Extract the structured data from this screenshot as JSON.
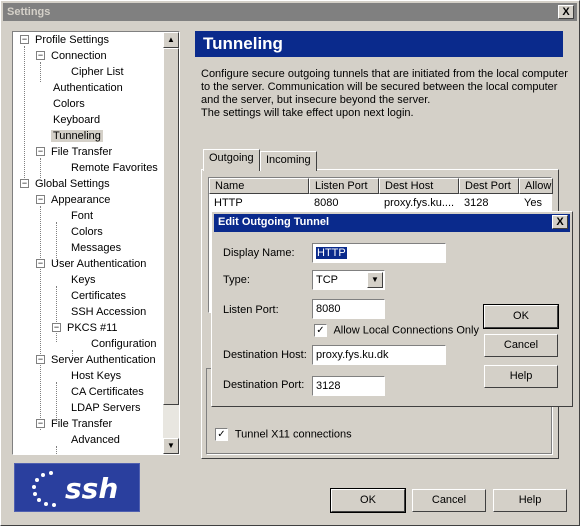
{
  "window": {
    "title": "Settings",
    "close_glyph": "X"
  },
  "tree": {
    "items": [
      {
        "label": "Profile Settings"
      },
      {
        "label": "Connection"
      },
      {
        "label": "Cipher List"
      },
      {
        "label": "Authentication"
      },
      {
        "label": "Colors"
      },
      {
        "label": "Keyboard"
      },
      {
        "label": "Tunneling"
      },
      {
        "label": "File Transfer"
      },
      {
        "label": "Remote Favorites"
      },
      {
        "label": "Global Settings"
      },
      {
        "label": "Appearance"
      },
      {
        "label": "Font"
      },
      {
        "label": "Colors"
      },
      {
        "label": "Messages"
      },
      {
        "label": "User Authentication"
      },
      {
        "label": "Keys"
      },
      {
        "label": "Certificates"
      },
      {
        "label": "SSH Accession"
      },
      {
        "label": "PKCS #11"
      },
      {
        "label": "Configuration"
      },
      {
        "label": "Server Authentication"
      },
      {
        "label": "Host Keys"
      },
      {
        "label": "CA Certificates"
      },
      {
        "label": "LDAP Servers"
      },
      {
        "label": "File Transfer"
      },
      {
        "label": "Advanced"
      }
    ],
    "selected": "Tunneling",
    "expander_minus": "−"
  },
  "logo": {
    "text": "ssh"
  },
  "panel": {
    "title": "Tunneling",
    "description": [
      "Configure secure outgoing tunnels that are initiated from the local computer",
      "to the server. Communication will be secured between the local computer",
      "and the server, but insecure beyond the server.",
      "The settings will take effect upon next login."
    ],
    "tabs": [
      "Outgoing",
      "Incoming"
    ],
    "table": {
      "columns": [
        "Name",
        "Listen Port",
        "Dest Host",
        "Dest Port",
        "Allow"
      ],
      "rows": [
        [
          "HTTP",
          "8080",
          "proxy.fys.ku....",
          "3128",
          "Yes"
        ]
      ]
    },
    "x11_label": "Tunnel X11 connections",
    "x11_checked": "✓"
  },
  "footer": {
    "ok": "OK",
    "cancel": "Cancel",
    "help": "Help"
  },
  "dialog": {
    "title": "Edit Outgoing Tunnel",
    "close_glyph": "X",
    "display_name_label": "Display Name:",
    "display_name_value": "HTTP",
    "type_label": "Type:",
    "type_value": "TCP",
    "listen_port_label": "Listen Port:",
    "listen_port_value": "8080",
    "allow_local_label": "Allow Local Connections Only",
    "allow_local_checked": "✓",
    "dest_host_label": "Destination Host:",
    "dest_host_value": "proxy.fys.ku.dk",
    "dest_port_label": "Destination Port:",
    "dest_port_value": "3128",
    "ok": "OK",
    "cancel": "Cancel",
    "help": "Help"
  }
}
